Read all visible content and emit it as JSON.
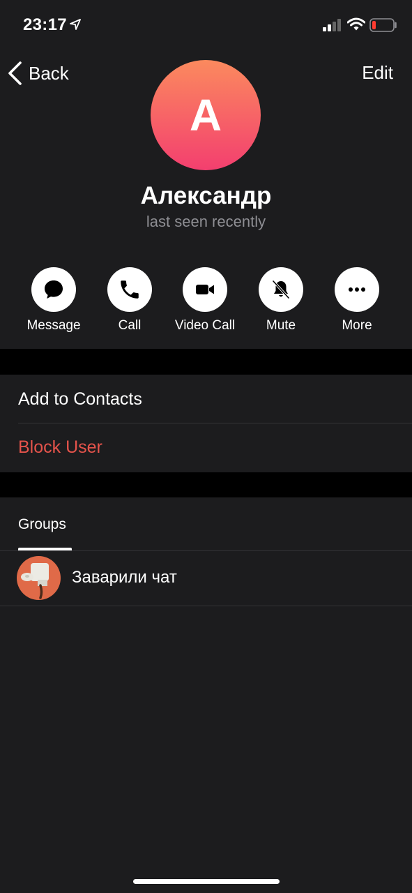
{
  "status_bar": {
    "time": "23:17"
  },
  "nav": {
    "back_label": "Back",
    "edit_label": "Edit"
  },
  "profile": {
    "avatar_letter": "A",
    "name": "Александр",
    "status": "last seen recently"
  },
  "actions": [
    {
      "label": "Message",
      "icon": "message-bubble-icon"
    },
    {
      "label": "Call",
      "icon": "phone-icon"
    },
    {
      "label": "Video Call",
      "icon": "video-camera-icon"
    },
    {
      "label": "Mute",
      "icon": "bell-slash-icon"
    },
    {
      "label": "More",
      "icon": "ellipsis-icon"
    }
  ],
  "menu": {
    "add_to_contacts": "Add to Contacts",
    "block_user": "Block User"
  },
  "tabs": {
    "groups": "Groups"
  },
  "groups": [
    {
      "name": "Заварили чат"
    }
  ],
  "colors": {
    "background": "#1c1c1e",
    "accent_danger": "#e5534b",
    "avatar_top": "#fb8a5e",
    "avatar_bottom": "#f33f6f"
  }
}
